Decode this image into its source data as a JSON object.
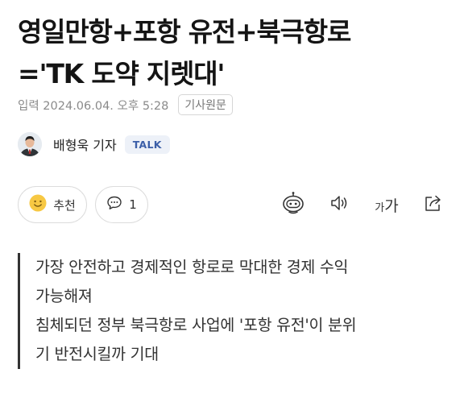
{
  "article": {
    "headline_line1": "영일만항+포항 유전+북극항로",
    "headline_line2": "='TK 도약 지렛대'",
    "published": "입력 2024.06.04. 오후 5:28",
    "original_label": "기사원문",
    "reporter_name": "배형욱 기자",
    "talk_label": "TALK",
    "summary": [
      "가장 안전하고 경제적인 항로로 막대한 경제 수익",
      "가능해져",
      "침체되던 정부 북극항로 사업에 '포항 유전'이 분위",
      "기 반전시킬까 기대"
    ]
  },
  "actions": {
    "recommend_label": "추천",
    "comment_count": "1",
    "font_size_label_small": "가",
    "font_size_label_large": "가",
    "icons": [
      "smile-icon",
      "comment-icon",
      "robot-summary-icon",
      "speaker-icon",
      "font-size-icon",
      "share-icon"
    ]
  },
  "colors": {
    "talk_badge_bg": "#edf1f8",
    "talk_badge_text": "#3c5fa8",
    "smile_icon": "#f7c843"
  }
}
